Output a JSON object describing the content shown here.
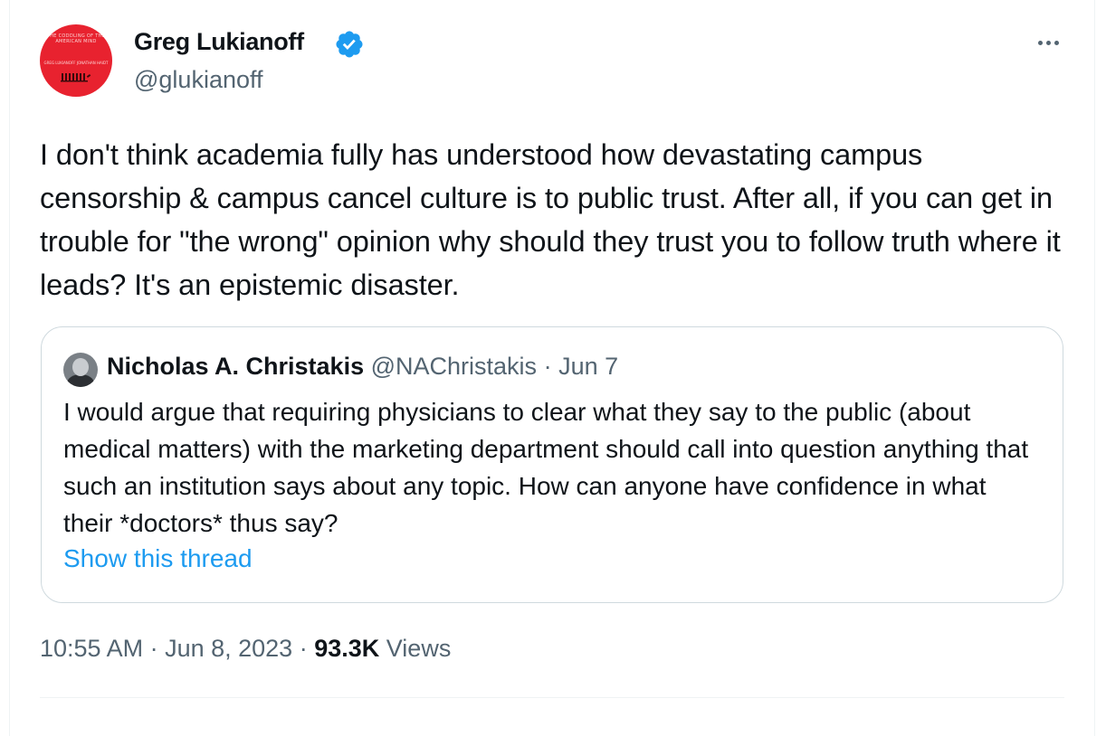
{
  "author": {
    "display_name": "Greg Lukianoff",
    "handle": "@glukianoff",
    "avatar_title": "THE CODDLING OF THE AMERICAN MIND",
    "avatar_authors": "GREG LUKIANOFF JONATHAN HAIDT",
    "verified_color": "#1d9bf0"
  },
  "tweet": {
    "text": "I don't think academia fully has understood how devastating campus censorship & campus cancel culture is to public trust. After all, if you can get in trouble for \"the wrong\" opinion why should they trust you to follow truth where it leads? It's an epistemic disaster.",
    "time": "10:55 AM",
    "date": "Jun 8, 2023",
    "views_count": "93.3K",
    "views_label": "Views",
    "separator": " · "
  },
  "quote": {
    "display_name": "Nicholas A. Christakis",
    "handle": "@NAChristakis",
    "date": "Jun 7",
    "text": "I would argue that requiring physicians to clear what they say to the public (about medical matters) with the marketing department should call into question anything that such an institution says about any topic. How can anyone have confidence in what their *doctors* thus say?",
    "show_thread": "Show this thread"
  },
  "colors": {
    "text": "#0f1419",
    "secondary": "#536471",
    "link": "#1d9bf0",
    "avatar_red": "#e8222f"
  }
}
